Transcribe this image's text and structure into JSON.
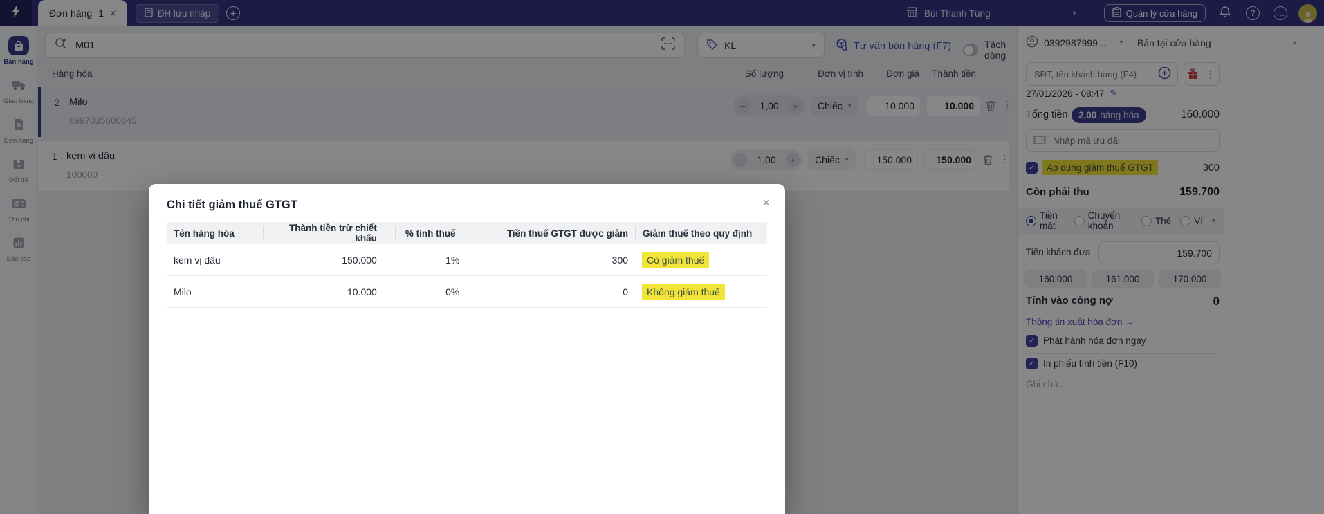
{
  "icons": {
    "caret": "▾",
    "dots_v": "⋮",
    "close": "×",
    "check": "✓",
    "plus": "+",
    "minus": "−",
    "more": "…",
    "question": "?",
    "pencil": "✎",
    "count_badge": "1"
  },
  "topbar": {
    "tab_label": "Đơn hàng",
    "tab_count": "1",
    "draft_tab_label": "ĐH lưu nháp",
    "user_name": "Bùi Thanh Tùng",
    "manage_store_label": "Quản lý cửa hàng"
  },
  "sidebar": {
    "items": [
      {
        "label": "Bán hàng"
      },
      {
        "label": "Giao hàng"
      },
      {
        "label": "Đơn hàng"
      },
      {
        "label": "Đổi trả"
      },
      {
        "label": "Thu chi"
      },
      {
        "label": "Báo cáo"
      }
    ]
  },
  "main": {
    "search_value": "M01",
    "price_list": "KL",
    "consult_label": "Tư vấn bán hàng (F7)",
    "split_line_label": "Tách dòng",
    "table": {
      "headers": {
        "product": "Hàng hóa",
        "qty": "Số lượng",
        "unit": "Đơn vị tính",
        "price": "Đơn giá",
        "total": "Thành tiền"
      },
      "rows": [
        {
          "line": "2",
          "name": "Milo",
          "code": "8997035600645",
          "qty": "1,00",
          "unit": "Chiếc",
          "price": "10.000",
          "total": "10.000"
        },
        {
          "line": "1",
          "name": "kem vị dâu",
          "code": "100000",
          "qty": "1,00",
          "unit": "Chiếc",
          "price": "150.000",
          "total": "150.000"
        }
      ]
    }
  },
  "panel": {
    "customer_phone": "0392987999 ...",
    "sale_channel": "Bán tại cửa hàng",
    "customer_search_placeholder": "SĐT, tên khách hàng (F4)",
    "datetime": "27/01/2026 - 08:47",
    "total_label": "Tổng tiền",
    "total_badge_qty": "2,00",
    "total_badge_text": "hàng hóa",
    "total_value": "160.000",
    "promo_placeholder": "Nhập mã ưu đãi",
    "vat_label": "Áp dụng giảm thuế GTGT",
    "vat_value": "300",
    "due_label": "Còn phải thu",
    "due_value": "159.700",
    "payment_methods": {
      "cash": "Tiền mặt",
      "transfer": "Chuyển khoản",
      "card": "Thẻ",
      "wallet": "Ví"
    },
    "customer_cash_label": "Tiền khách đưa",
    "customer_cash_value": "159.700",
    "quick_amounts": [
      "160.000",
      "161.000",
      "170.000"
    ],
    "debt_label": "Tính vào công nợ",
    "debt_value": "0",
    "invoice_info_link": "Thông tin xuất hóa đơn →",
    "issue_invoice_label": "Phát hành hóa đơn ngay",
    "print_receipt_label": "In phiếu tính tiền (F10)",
    "note_placeholder": "Ghi chú..."
  },
  "modal": {
    "title": "Chi tiết giảm thuế GTGT",
    "headers": [
      "Tên hàng hóa",
      "Thành tiền trừ chiết khấu",
      "% tính thuế",
      "Tiền thuế GTGT được giảm",
      "Giảm thuế theo quy định"
    ],
    "rows": [
      {
        "name": "kem vị dâu",
        "amount": "150.000",
        "rate": "1%",
        "reduced": "300",
        "status": "Có giảm thuế"
      },
      {
        "name": "Milo",
        "amount": "10.000",
        "rate": "0%",
        "reduced": "0",
        "status": "Không giảm thuế"
      }
    ]
  }
}
